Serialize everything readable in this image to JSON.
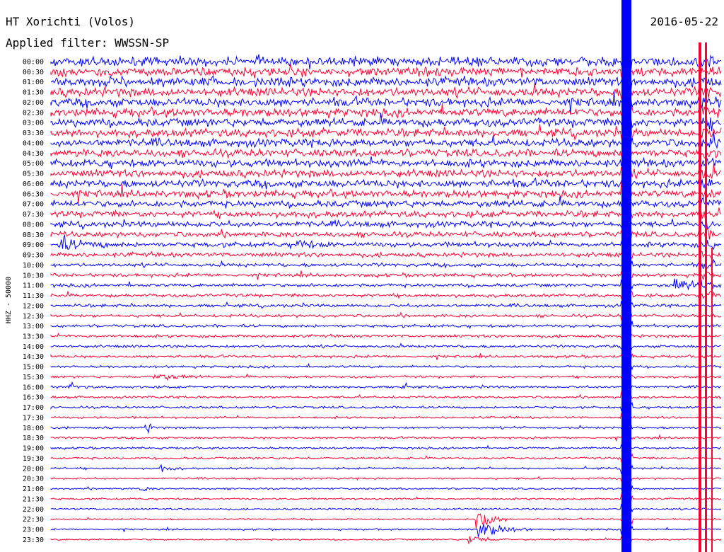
{
  "chart_data": {
    "type": "line",
    "title": "HT Xorichti (Volos)",
    "subtitle": "Applied filter: WWSSN-SP",
    "date": "2016-05-22",
    "ylabel": "HHZ - 50000",
    "y_tick_labels": [
      "00:00",
      "00:30",
      "01:00",
      "01:30",
      "02:00",
      "02:30",
      "03:00",
      "03:30",
      "04:00",
      "04:30",
      "05:00",
      "05:30",
      "06:00",
      "06:30",
      "07:00",
      "07:30",
      "08:00",
      "08:30",
      "09:00",
      "09:30",
      "10:00",
      "10:30",
      "11:00",
      "11:30",
      "12:00",
      "12:30",
      "13:00",
      "13:30",
      "14:00",
      "14:30",
      "15:00",
      "15:30",
      "16:00",
      "16:30",
      "17:00",
      "17:30",
      "18:00",
      "18:30",
      "19:00",
      "19:30",
      "20:00",
      "20:30",
      "21:00",
      "21:30",
      "22:00",
      "22:30",
      "23:00",
      "23:30"
    ],
    "row_minutes": 30,
    "row_colors": [
      "#0000ff",
      "#ff0033"
    ],
    "grid": false,
    "legend": "none"
  }
}
